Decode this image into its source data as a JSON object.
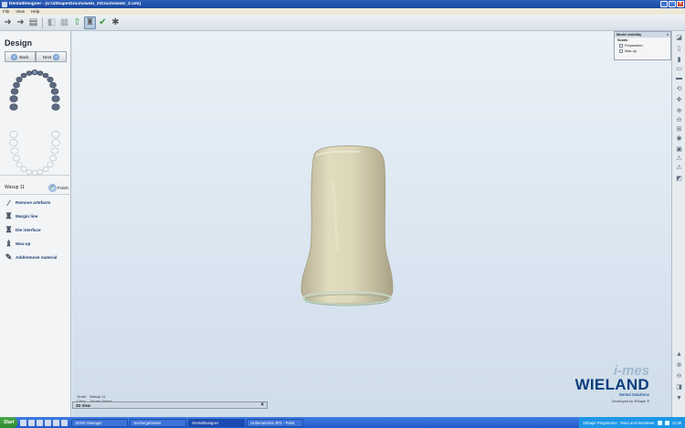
{
  "window": {
    "title": "DentalDesigner - [U:\\3Shape\\Gruchowski_2\\Gruchowski_2.xml]",
    "minimize": "_",
    "maximize": "□",
    "close": "×"
  },
  "menu": [
    "File",
    "View",
    "Help"
  ],
  "toolbar": {
    "icons": [
      "arrow-left-icon",
      "arrow-right-icon",
      "stack-icon",
      "model-icon",
      "grid-icon",
      "arrow-up-icon",
      "design-icon",
      "check-icon",
      "tools-icon"
    ]
  },
  "left_panel": {
    "title": "Design",
    "back_label": "Back",
    "next_label": "Next",
    "waxup_label": "Waxup 11",
    "finish_label": "Finish",
    "tools": [
      {
        "label": "Remove artefacts",
        "icon": "knife-icon"
      },
      {
        "label": "Margin line",
        "icon": "margin-tooth-icon"
      },
      {
        "label": "Die interface",
        "icon": "die-icon"
      },
      {
        "label": "Wax-up",
        "icon": "waxup-icon"
      },
      {
        "label": "Add/remove material",
        "icon": "material-icon"
      }
    ]
  },
  "model_visibility": {
    "title": "Model visibility",
    "close": "×",
    "group": "Scans",
    "items": [
      {
        "label": "Preparation",
        "checked": false
      },
      {
        "label": "Wax-up",
        "checked": false
      }
    ]
  },
  "order_info": {
    "order_label": "Order:",
    "order_value": "Waxup 11",
    "clinic_label": "Clinic:",
    "clinic_value": "Jürgen Siegel"
  },
  "logo": {
    "imes": "i-mes",
    "wieland": "WIELAND",
    "subtitle": "Dental Solutions",
    "developed": "Developed by 3Shape ®"
  },
  "view_bar": {
    "label": "3D View",
    "close": "×"
  },
  "taskbar": {
    "start": "Start",
    "tasks": [
      {
        "label": "ZENO Manager",
        "active": false
      },
      {
        "label": "Suchergebnisse",
        "active": false
      },
      {
        "label": "DentalDesigner",
        "active": true
      },
      {
        "label": "Unbenannt19.JPG - Paint",
        "active": false
      }
    ],
    "tray_items": [
      "3Shape Programme",
      "Team and Netviewer"
    ],
    "clock": "11:38"
  },
  "colors": {
    "model": "#d8d2b4",
    "title_bar": "#1a47a0",
    "accent": "#0a3e7c"
  }
}
